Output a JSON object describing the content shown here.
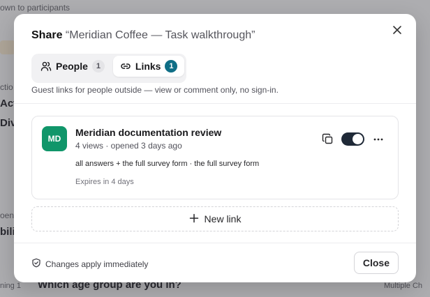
{
  "background": {
    "top_text": "own to participants",
    "left_fragments": [
      "ctio",
      "Acti",
      "Divi",
      "oen",
      "bili",
      "ning 1"
    ],
    "bottom_question": "Which age group are you in?",
    "bottom_right": "Multiple Ch"
  },
  "modal": {
    "title_prefix": "Share",
    "title_quoted": "“Meridian Coffee — Task walkthrough”",
    "close_icon": "close-icon",
    "tabs": [
      {
        "label": "People",
        "count": "1",
        "icon": "people-icon",
        "active": false
      },
      {
        "label": "Links",
        "count": "1",
        "icon": "link-icon",
        "active": true
      }
    ],
    "description": "Guest links for people outside — view or comment only, no sign-in.",
    "link": {
      "avatar_initials": "MD",
      "avatar_color": "#10966a",
      "title": "Meridian documentation review",
      "meta": "4 views · opened 3 days ago",
      "scope": "all answers + the full survey form · the full survey form",
      "expiry": "Expires in 4 days",
      "enabled": true
    },
    "new_link_label": "New link",
    "footer_note": "Changes apply immediately",
    "close_button": "Close"
  },
  "colors": {
    "accent": "#0f6e86",
    "toggle_on": "#1f2937"
  }
}
